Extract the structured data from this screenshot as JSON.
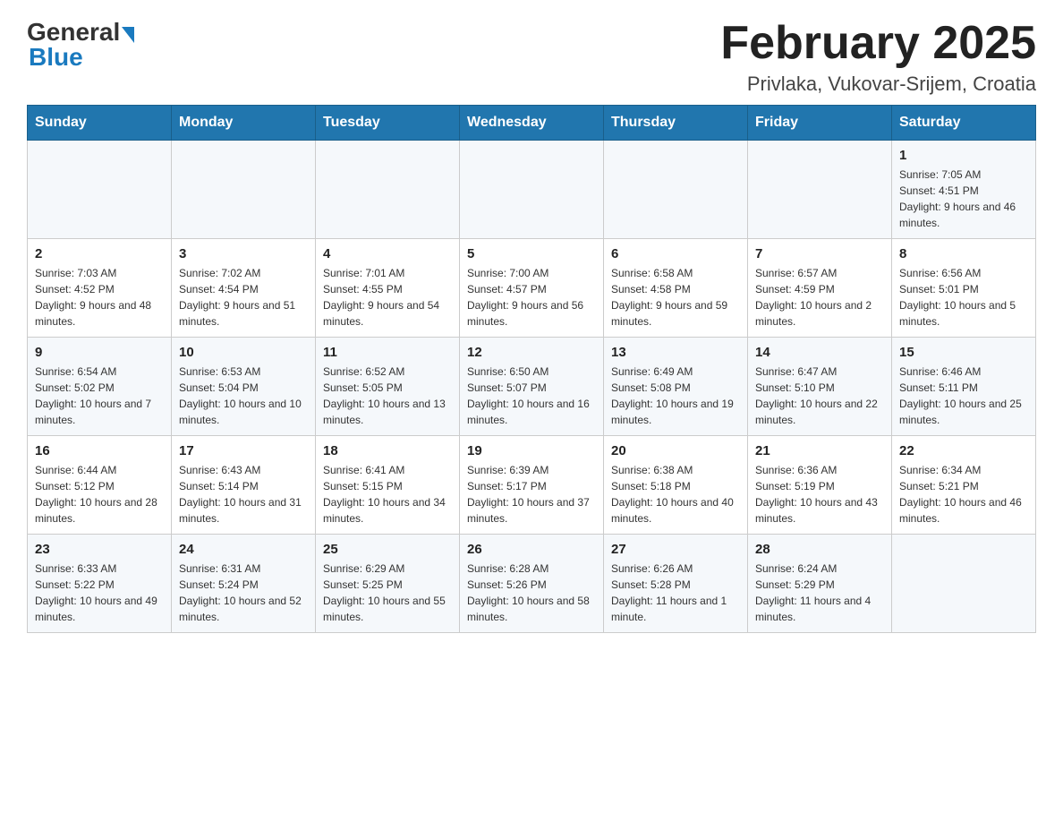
{
  "logo": {
    "general": "General",
    "blue": "Blue"
  },
  "header": {
    "month_year": "February 2025",
    "location": "Privlaka, Vukovar-Srijem, Croatia"
  },
  "days_of_week": [
    "Sunday",
    "Monday",
    "Tuesday",
    "Wednesday",
    "Thursday",
    "Friday",
    "Saturday"
  ],
  "weeks": [
    [
      {
        "day": "",
        "info": ""
      },
      {
        "day": "",
        "info": ""
      },
      {
        "day": "",
        "info": ""
      },
      {
        "day": "",
        "info": ""
      },
      {
        "day": "",
        "info": ""
      },
      {
        "day": "",
        "info": ""
      },
      {
        "day": "1",
        "info": "Sunrise: 7:05 AM\nSunset: 4:51 PM\nDaylight: 9 hours and 46 minutes."
      }
    ],
    [
      {
        "day": "2",
        "info": "Sunrise: 7:03 AM\nSunset: 4:52 PM\nDaylight: 9 hours and 48 minutes."
      },
      {
        "day": "3",
        "info": "Sunrise: 7:02 AM\nSunset: 4:54 PM\nDaylight: 9 hours and 51 minutes."
      },
      {
        "day": "4",
        "info": "Sunrise: 7:01 AM\nSunset: 4:55 PM\nDaylight: 9 hours and 54 minutes."
      },
      {
        "day": "5",
        "info": "Sunrise: 7:00 AM\nSunset: 4:57 PM\nDaylight: 9 hours and 56 minutes."
      },
      {
        "day": "6",
        "info": "Sunrise: 6:58 AM\nSunset: 4:58 PM\nDaylight: 9 hours and 59 minutes."
      },
      {
        "day": "7",
        "info": "Sunrise: 6:57 AM\nSunset: 4:59 PM\nDaylight: 10 hours and 2 minutes."
      },
      {
        "day": "8",
        "info": "Sunrise: 6:56 AM\nSunset: 5:01 PM\nDaylight: 10 hours and 5 minutes."
      }
    ],
    [
      {
        "day": "9",
        "info": "Sunrise: 6:54 AM\nSunset: 5:02 PM\nDaylight: 10 hours and 7 minutes."
      },
      {
        "day": "10",
        "info": "Sunrise: 6:53 AM\nSunset: 5:04 PM\nDaylight: 10 hours and 10 minutes."
      },
      {
        "day": "11",
        "info": "Sunrise: 6:52 AM\nSunset: 5:05 PM\nDaylight: 10 hours and 13 minutes."
      },
      {
        "day": "12",
        "info": "Sunrise: 6:50 AM\nSunset: 5:07 PM\nDaylight: 10 hours and 16 minutes."
      },
      {
        "day": "13",
        "info": "Sunrise: 6:49 AM\nSunset: 5:08 PM\nDaylight: 10 hours and 19 minutes."
      },
      {
        "day": "14",
        "info": "Sunrise: 6:47 AM\nSunset: 5:10 PM\nDaylight: 10 hours and 22 minutes."
      },
      {
        "day": "15",
        "info": "Sunrise: 6:46 AM\nSunset: 5:11 PM\nDaylight: 10 hours and 25 minutes."
      }
    ],
    [
      {
        "day": "16",
        "info": "Sunrise: 6:44 AM\nSunset: 5:12 PM\nDaylight: 10 hours and 28 minutes."
      },
      {
        "day": "17",
        "info": "Sunrise: 6:43 AM\nSunset: 5:14 PM\nDaylight: 10 hours and 31 minutes."
      },
      {
        "day": "18",
        "info": "Sunrise: 6:41 AM\nSunset: 5:15 PM\nDaylight: 10 hours and 34 minutes."
      },
      {
        "day": "19",
        "info": "Sunrise: 6:39 AM\nSunset: 5:17 PM\nDaylight: 10 hours and 37 minutes."
      },
      {
        "day": "20",
        "info": "Sunrise: 6:38 AM\nSunset: 5:18 PM\nDaylight: 10 hours and 40 minutes."
      },
      {
        "day": "21",
        "info": "Sunrise: 6:36 AM\nSunset: 5:19 PM\nDaylight: 10 hours and 43 minutes."
      },
      {
        "day": "22",
        "info": "Sunrise: 6:34 AM\nSunset: 5:21 PM\nDaylight: 10 hours and 46 minutes."
      }
    ],
    [
      {
        "day": "23",
        "info": "Sunrise: 6:33 AM\nSunset: 5:22 PM\nDaylight: 10 hours and 49 minutes."
      },
      {
        "day": "24",
        "info": "Sunrise: 6:31 AM\nSunset: 5:24 PM\nDaylight: 10 hours and 52 minutes."
      },
      {
        "day": "25",
        "info": "Sunrise: 6:29 AM\nSunset: 5:25 PM\nDaylight: 10 hours and 55 minutes."
      },
      {
        "day": "26",
        "info": "Sunrise: 6:28 AM\nSunset: 5:26 PM\nDaylight: 10 hours and 58 minutes."
      },
      {
        "day": "27",
        "info": "Sunrise: 6:26 AM\nSunset: 5:28 PM\nDaylight: 11 hours and 1 minute."
      },
      {
        "day": "28",
        "info": "Sunrise: 6:24 AM\nSunset: 5:29 PM\nDaylight: 11 hours and 4 minutes."
      },
      {
        "day": "",
        "info": ""
      }
    ]
  ]
}
